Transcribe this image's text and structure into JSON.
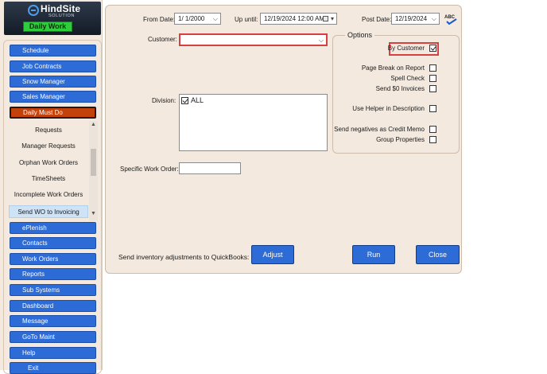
{
  "logo": {
    "name": "HindSite",
    "subtitle": "SOLUTION",
    "badge": "Daily Work"
  },
  "nav": {
    "top": [
      "Schedule",
      "Job Contracts",
      "Snow Manager",
      "Sales Manager",
      "Daily Must Do"
    ],
    "active": "Daily Must Do",
    "submenu": [
      "Requests",
      "Manager Requests",
      "Orphan Work Orders",
      "TimeSheets",
      "Incomplete Work Orders",
      "Send WO to Invoicing"
    ],
    "submenu_selected": "Send WO to Invoicing",
    "bottom": [
      "ePlenish",
      "Contacts",
      "Work Orders",
      "Reports",
      "Sub Systems",
      "Dashboard",
      "Message",
      "GoTo Maint",
      "Help",
      "Exit"
    ]
  },
  "form": {
    "from_date_label": "From Date:",
    "from_date_value": "1/  1/2000",
    "up_until_label": "Up until:",
    "up_until_value": "12/19/2024 12:00 AM",
    "post_date_label": "Post Date:",
    "post_date_value": "12/19/2024",
    "customer_label": "Customer:",
    "customer_value": "",
    "division_label": "Division:",
    "division_items": [
      {
        "label": "ALL",
        "checked": true
      }
    ],
    "specific_wo_label": "Specific Work Order:",
    "specific_wo_value": "",
    "inventory_label": "Send inventory adjustments to QuickBooks:",
    "adjust_button": "Adjust",
    "run_button": "Run",
    "close_button": "Close",
    "spell_icon_text": "ABC"
  },
  "options": {
    "title": "Options",
    "by_customer": {
      "label": "By Customer",
      "checked": true
    },
    "items": [
      {
        "label": "Page Break on Report",
        "checked": false
      },
      {
        "label": "Spell Check",
        "checked": false
      },
      {
        "label": "Send $0 Invoices",
        "checked": false
      },
      {
        "label": "Use Helper in Description",
        "checked": false
      },
      {
        "label": "Send negatives as Credit Memo",
        "checked": false
      },
      {
        "label": "Group Properties",
        "checked": false
      }
    ]
  },
  "colors": {
    "nav_button": "#2d6bd6",
    "nav_active": "#c3410b",
    "panel_bg": "#f3e9df",
    "highlight_border": "#d64040"
  }
}
